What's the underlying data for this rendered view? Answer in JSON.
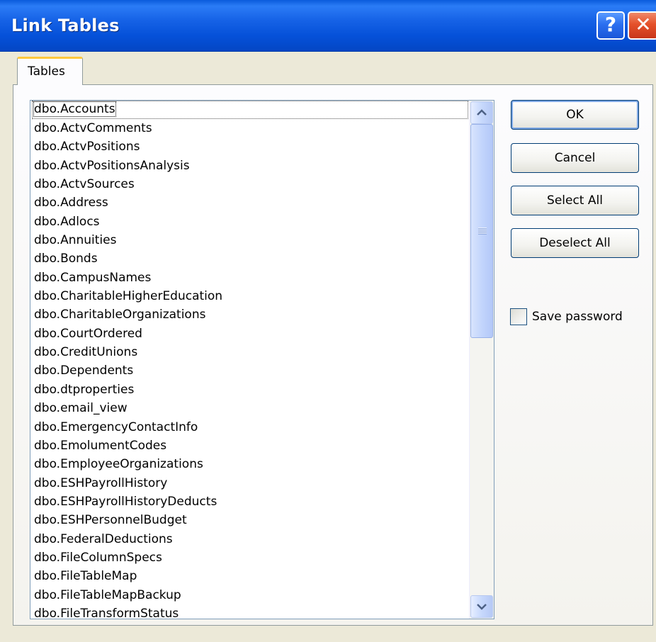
{
  "window": {
    "title": "Link Tables"
  },
  "titlebar_buttons": {
    "help": "?",
    "close": "✕"
  },
  "tabs": [
    {
      "label": "Tables"
    }
  ],
  "tables": {
    "items": [
      "dbo.Accounts",
      "dbo.ActvComments",
      "dbo.ActvPositions",
      "dbo.ActvPositionsAnalysis",
      "dbo.ActvSources",
      "dbo.Address",
      "dbo.Adlocs",
      "dbo.Annuities",
      "dbo.Bonds",
      "dbo.CampusNames",
      "dbo.CharitableHigherEducation",
      "dbo.CharitableOrganizations",
      "dbo.CourtOrdered",
      "dbo.CreditUnions",
      "dbo.Dependents",
      "dbo.dtproperties",
      "dbo.email_view",
      "dbo.EmergencyContactInfo",
      "dbo.EmolumentCodes",
      "dbo.EmployeeOrganizations",
      "dbo.ESHPayrollHistory",
      "dbo.ESHPayrollHistoryDeducts",
      "dbo.ESHPersonnelBudget",
      "dbo.FederalDeductions",
      "dbo.FileColumnSpecs",
      "dbo.FileTableMap",
      "dbo.FileTableMapBackup",
      "dbo.FileTransformStatus"
    ],
    "focused_index": 0
  },
  "buttons": {
    "ok": "OK",
    "cancel": "Cancel",
    "select_all": "Select All",
    "deselect_all": "Deselect All"
  },
  "options": {
    "save_password_label": "Save password",
    "save_password_checked": false
  },
  "icons": {
    "scroll_up": "chevron-up-icon",
    "scroll_down": "chevron-down-icon"
  },
  "colors": {
    "titlebar": "#0551d9",
    "window_bg": "#ece9d8",
    "tab_accent": "#ffc83c",
    "close_button": "#e5512a"
  }
}
